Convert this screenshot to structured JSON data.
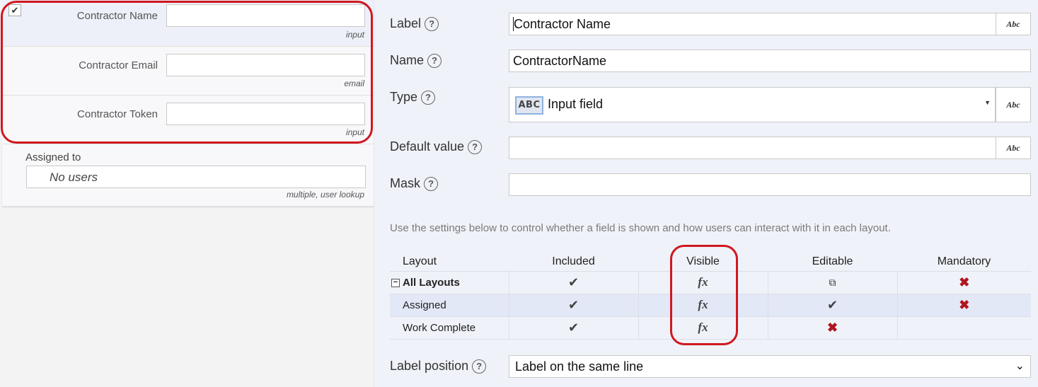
{
  "left": {
    "fields": [
      {
        "label": "Contractor Name",
        "hint": "input",
        "checked": true
      },
      {
        "label": "Contractor Email",
        "hint": "email"
      },
      {
        "label": "Contractor Token",
        "hint": "input"
      }
    ],
    "assigned": {
      "label": "Assigned to",
      "value": "No users",
      "hint": "multiple, user lookup"
    }
  },
  "props": {
    "label": {
      "title": "Label",
      "value": "Contractor Name",
      "abc": "Abc"
    },
    "name": {
      "title": "Name",
      "value": "ContractorName"
    },
    "type": {
      "title": "Type",
      "badge": "ABC",
      "value": "Input field",
      "abc": "Abc"
    },
    "default_value": {
      "title": "Default value",
      "value": "",
      "abc": "Abc"
    },
    "mask": {
      "title": "Mask",
      "value": ""
    },
    "help_glyph": "?"
  },
  "note": "Use the settings below to control whether a field is shown and how users can interact with it in each layout.",
  "layouts": {
    "headers": [
      "Layout",
      "Included",
      "Visible",
      "Editable",
      "Mandatory"
    ],
    "collapse_glyph": "−",
    "rows": [
      {
        "name": "All Layouts",
        "included": "check",
        "visible": "fx",
        "editable": "copy",
        "mandatory": "x"
      },
      {
        "name": "Assigned",
        "included": "check",
        "visible": "fx",
        "editable": "check",
        "mandatory": "x"
      },
      {
        "name": "Work Complete",
        "included": "check",
        "visible": "fx",
        "editable": "x",
        "mandatory": ""
      }
    ],
    "glyphs": {
      "check": "✔",
      "fx": "fx",
      "x": "✖",
      "copy": "⧉"
    }
  },
  "label_position": {
    "title": "Label position",
    "value": "Label on the same line",
    "chevron": "⌄"
  },
  "colors": {
    "highlight": "#d0171f",
    "accent": "#8fb3e0",
    "x": "#b01620"
  }
}
